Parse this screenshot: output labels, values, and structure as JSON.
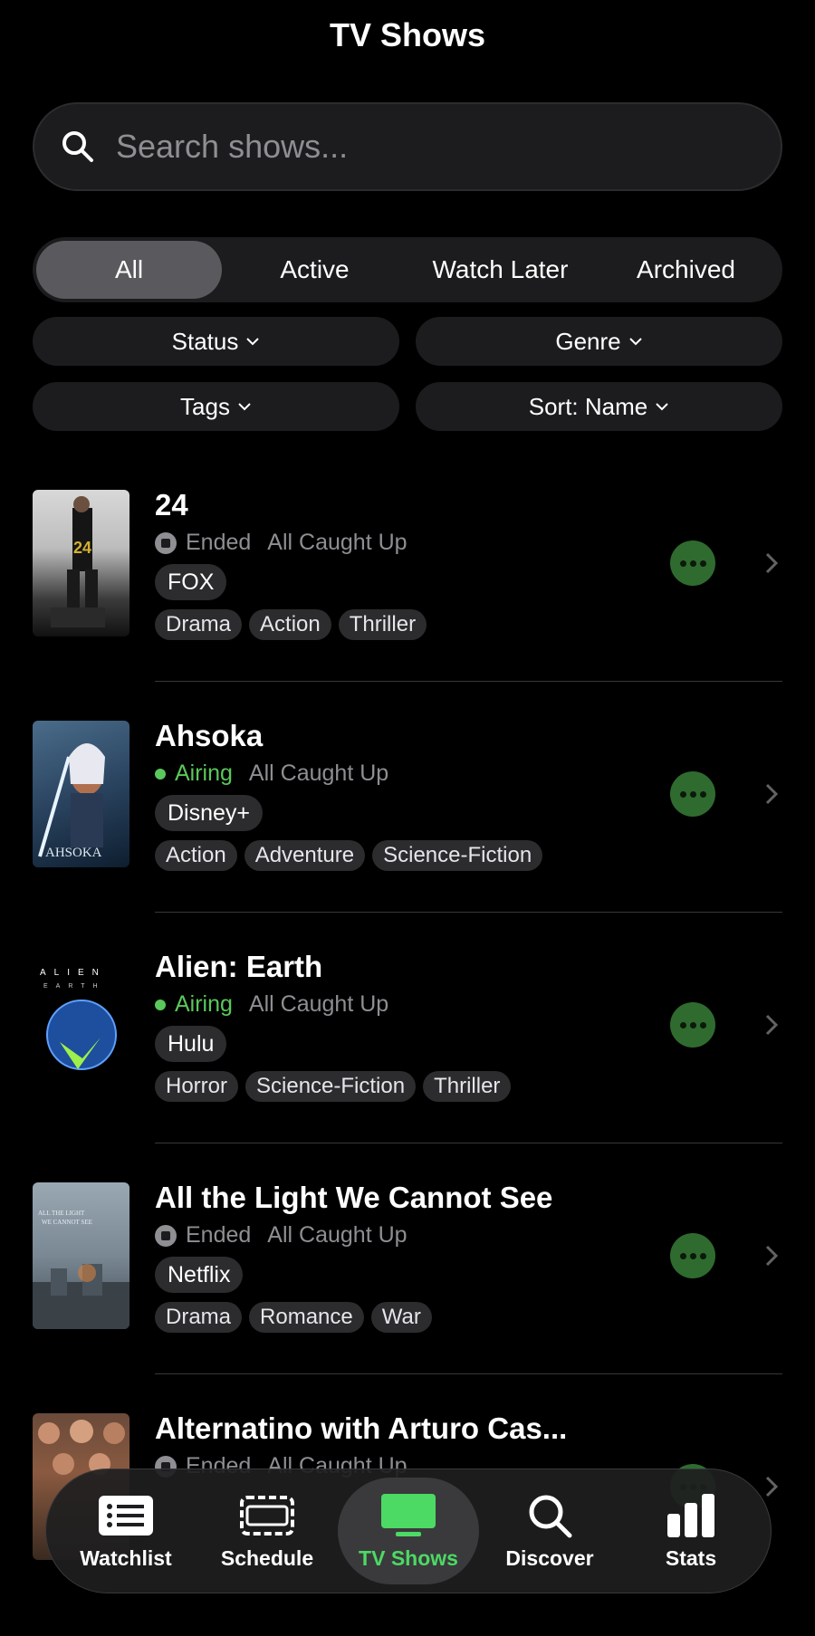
{
  "header": {
    "title": "TV Shows"
  },
  "search": {
    "placeholder": "Search shows..."
  },
  "segments": [
    {
      "label": "All",
      "active": true
    },
    {
      "label": "Active",
      "active": false
    },
    {
      "label": "Watch Later",
      "active": false
    },
    {
      "label": "Archived",
      "active": false
    }
  ],
  "filters": {
    "status": "Status",
    "genre": "Genre",
    "tags": "Tags",
    "sort": "Sort: Name"
  },
  "shows": [
    {
      "title": "24",
      "status": "Ended",
      "progress": "All Caught Up",
      "network": "FOX",
      "genres": [
        "Drama",
        "Action",
        "Thriller"
      ]
    },
    {
      "title": "Ahsoka",
      "status": "Airing",
      "progress": "All Caught Up",
      "network": "Disney+",
      "genres": [
        "Action",
        "Adventure",
        "Science-Fiction"
      ]
    },
    {
      "title": "Alien: Earth",
      "status": "Airing",
      "progress": "All Caught Up",
      "network": "Hulu",
      "genres": [
        "Horror",
        "Science-Fiction",
        "Thriller"
      ]
    },
    {
      "title": "All the Light We Cannot See",
      "status": "Ended",
      "progress": "All Caught Up",
      "network": "Netflix",
      "genres": [
        "Drama",
        "Romance",
        "War"
      ]
    },
    {
      "title": "Alternatino with Arturo Cas...",
      "status": "Ended",
      "progress": "All Caught Up",
      "network": "",
      "genres": []
    }
  ],
  "tabbar": {
    "items": [
      {
        "label": "Watchlist",
        "icon": "watchlist-icon",
        "active": false
      },
      {
        "label": "Schedule",
        "icon": "schedule-icon",
        "active": false
      },
      {
        "label": "TV Shows",
        "icon": "tv-icon",
        "active": true
      },
      {
        "label": "Discover",
        "icon": "search-icon",
        "active": false
      },
      {
        "label": "Stats",
        "icon": "stats-icon",
        "active": false
      }
    ]
  },
  "colors": {
    "accent": "#4cd964",
    "airing": "#5ac85a",
    "more_button": "#2f6b2f",
    "background": "#000000"
  }
}
